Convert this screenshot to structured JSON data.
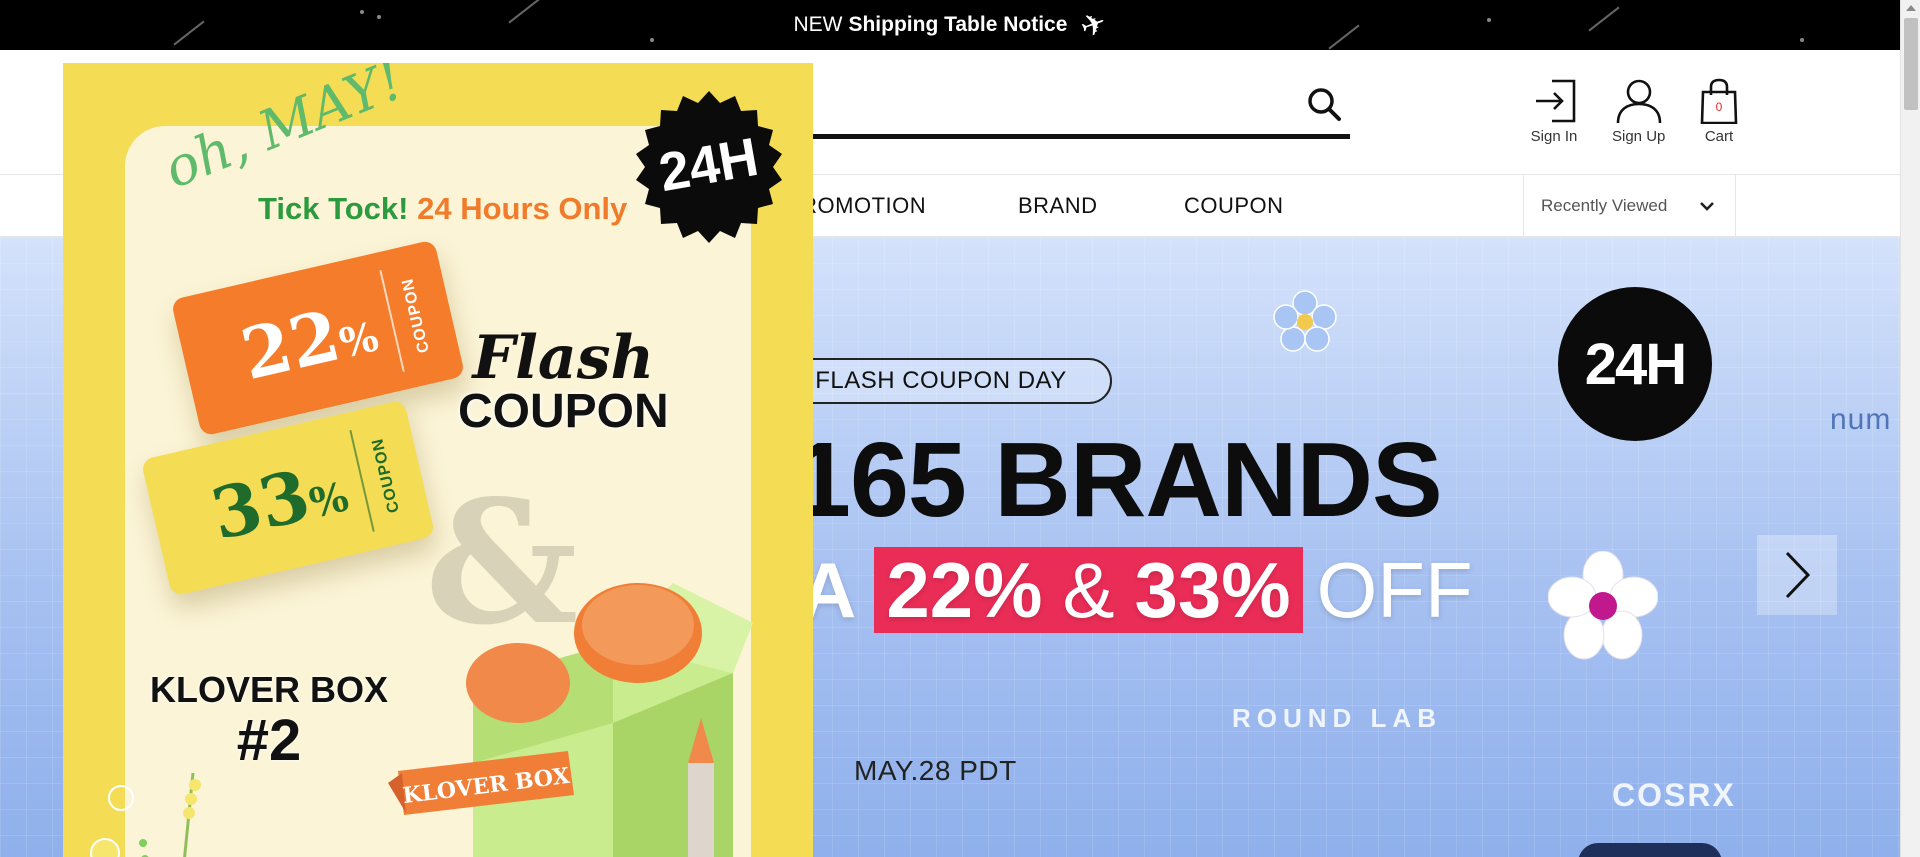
{
  "topbar": {
    "prefix": "NEW",
    "title": "Shipping Table Notice",
    "icon": "airplane-icon"
  },
  "header": {
    "search": {
      "placeholder": "",
      "icon": "search-icon"
    },
    "sign_in": "Sign In",
    "sign_up": "Sign Up",
    "cart": "Cart",
    "cart_count": "0"
  },
  "nav": {
    "items": [
      "PROMOTION",
      "BRAND",
      "COUPON"
    ],
    "recently_viewed": "Recently Viewed"
  },
  "hero": {
    "pill": "FLASH COUPON DAY",
    "headline": "165 BRANDS",
    "line2_prefix": "A",
    "line2_highlight_a": "22%",
    "line2_amp": "&",
    "line2_highlight_b": "33%",
    "line2_suffix": "OFF",
    "date": "MAY.28 PDT",
    "badge": "24H",
    "logos": [
      "num",
      "ROUND LAB",
      "COSRX"
    ],
    "accent": "#ea2d57"
  },
  "popup": {
    "script": "oh, MAY!",
    "tick_a": "Tick Tock!",
    "tick_b": "24 Hours Only",
    "badge": "24H",
    "coupon1_value": "22",
    "coupon1_unit": "%",
    "coupon1_label": "COUPON",
    "coupon2_value": "33",
    "coupon2_unit": "%",
    "coupon2_label": "COUPON",
    "flash": "Flash",
    "coupon_word": "COUPON",
    "amp": "&",
    "box_title": "KLOVER BOX",
    "box_number": "#2",
    "ribbon": "KLOVER BOX",
    "colors": {
      "yellow": "#f5dc55",
      "orange": "#f47c2a",
      "green": "#2b9b3d"
    }
  }
}
